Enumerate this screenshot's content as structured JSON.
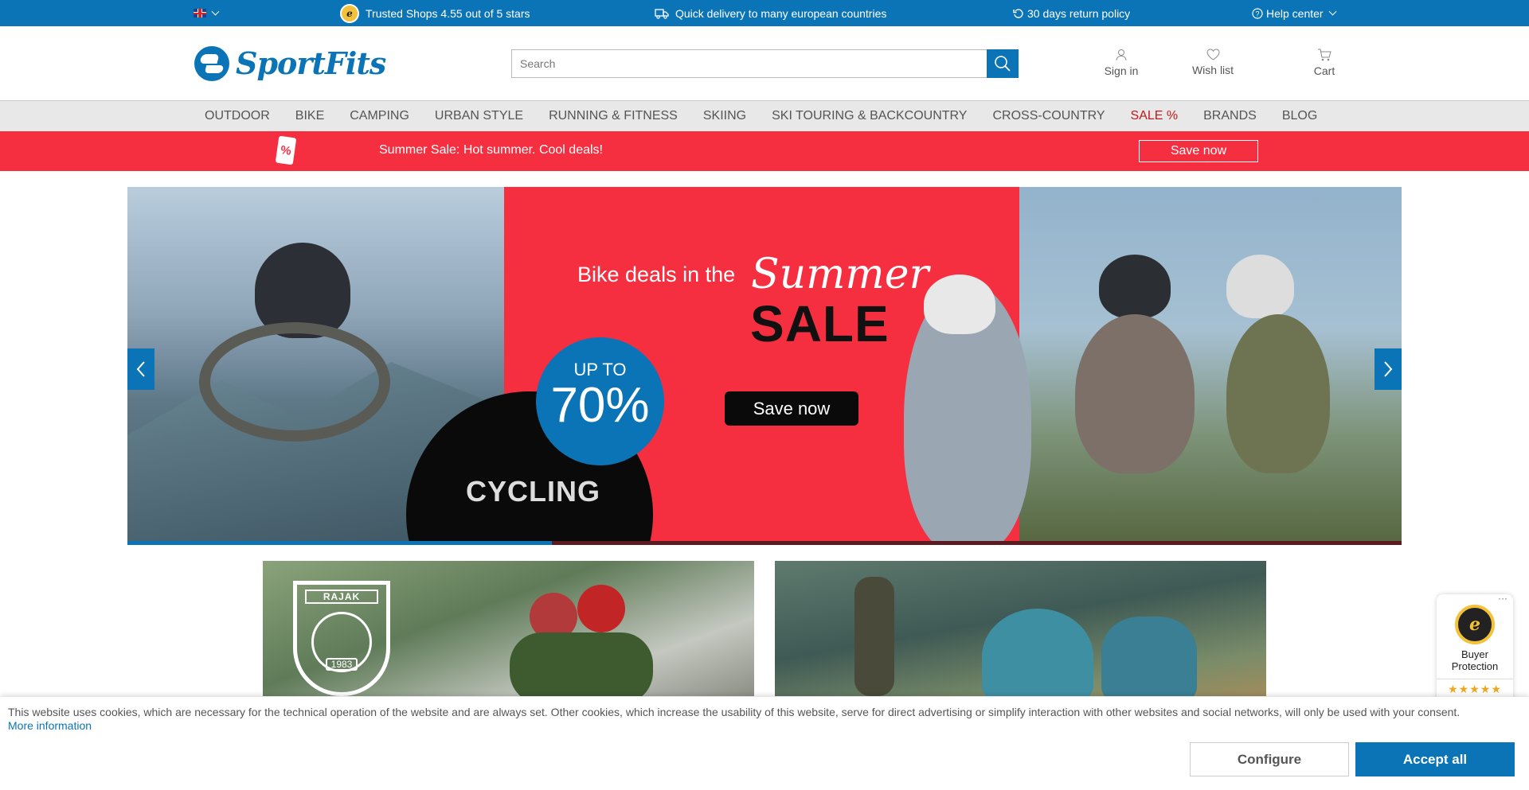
{
  "topbar": {
    "trusted": "Trusted Shops 4.55 out of 5 stars",
    "delivery": "Quick delivery to many european countries",
    "returns": "30 days return policy",
    "help": "Help center"
  },
  "header": {
    "logo_text": "SportFits",
    "search_placeholder": "Search",
    "sign_in": "Sign in",
    "wish_list": "Wish list",
    "cart": "Cart"
  },
  "nav": [
    "OUTDOOR",
    "BIKE",
    "CAMPING",
    "URBAN STYLE",
    "RUNNING & FITNESS",
    "SKIING",
    "SKI TOURING & BACKCOUNTRY",
    "CROSS-COUNTRY",
    "SALE %",
    "BRANDS",
    "BLOG"
  ],
  "promo": {
    "tag": "%",
    "text": "Summer Sale: Hot summer. Cool deals!",
    "button": "Save now"
  },
  "hero": {
    "headline": "Bike deals in the",
    "summer": "Summer",
    "sale": "SALE",
    "upto": "UP TO",
    "percent": "70%",
    "category": "CYCLING",
    "cta": "Save now",
    "slide_progress": 0.333
  },
  "tile1": {
    "brand": "RAJAK",
    "year": "1983"
  },
  "ts_widget": {
    "seal": "e",
    "label": "Buyer Protection",
    "stars": "★★★★★",
    "menu": "···"
  },
  "cookie": {
    "message": "This website uses cookies, which are necessary for the technical operation of the website and are always set. Other cookies, which increase the usability of this website, serve for direct advertising or simplify interaction with other websites and social networks, will only be used with your consent.",
    "more": "More information",
    "configure": "Configure",
    "accept": "Accept all"
  },
  "colors": {
    "brand_blue": "#0b74b6",
    "promo_red": "#f52f3f",
    "sale_red": "#c01818"
  }
}
